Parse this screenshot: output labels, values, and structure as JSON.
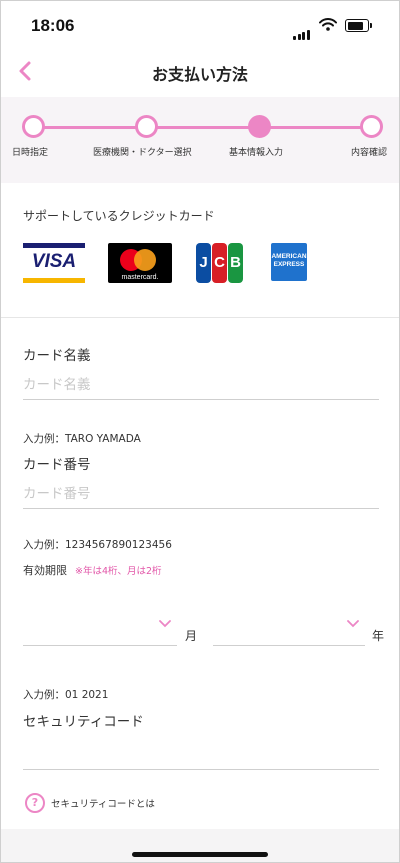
{
  "status_bar": {
    "time": "18:06"
  },
  "header": {
    "title": "お支払い方法"
  },
  "stepper": {
    "steps": [
      {
        "label": "日時指定",
        "active": false
      },
      {
        "label": "医療機関・ドクター選択",
        "active": false
      },
      {
        "label": "基本情報入力",
        "active": true
      },
      {
        "label": "内容確認",
        "active": false
      }
    ]
  },
  "cards": {
    "title": "サポートしているクレジットカード",
    "brands": [
      {
        "name": "VISA"
      },
      {
        "name": "mastercard."
      },
      {
        "name": "JCB",
        "letters": [
          "J",
          "C",
          "B"
        ]
      },
      {
        "name": "AMERICAN EXPRESS",
        "line1": "AMERICAN",
        "line2": "EXPRESS"
      }
    ]
  },
  "form": {
    "card_name": {
      "label": "カード名義",
      "placeholder": "カード名義",
      "example": "入力例：TARO YAMADA"
    },
    "card_number": {
      "label": "カード番号",
      "placeholder": "カード番号",
      "example": "入力例：1234567890123456"
    },
    "expiry": {
      "label": "有効期限",
      "note": "※年は4桁、月は2桁",
      "month_unit": "月",
      "year_unit": "年",
      "example": "入力例：01 2021"
    },
    "security_code": {
      "label": "セキュリティコード",
      "help_text": "セキュリティコードとは",
      "help_icon_glyph": "?"
    }
  },
  "colors": {
    "accent": "#ec86c5",
    "note": "#e256a8"
  }
}
